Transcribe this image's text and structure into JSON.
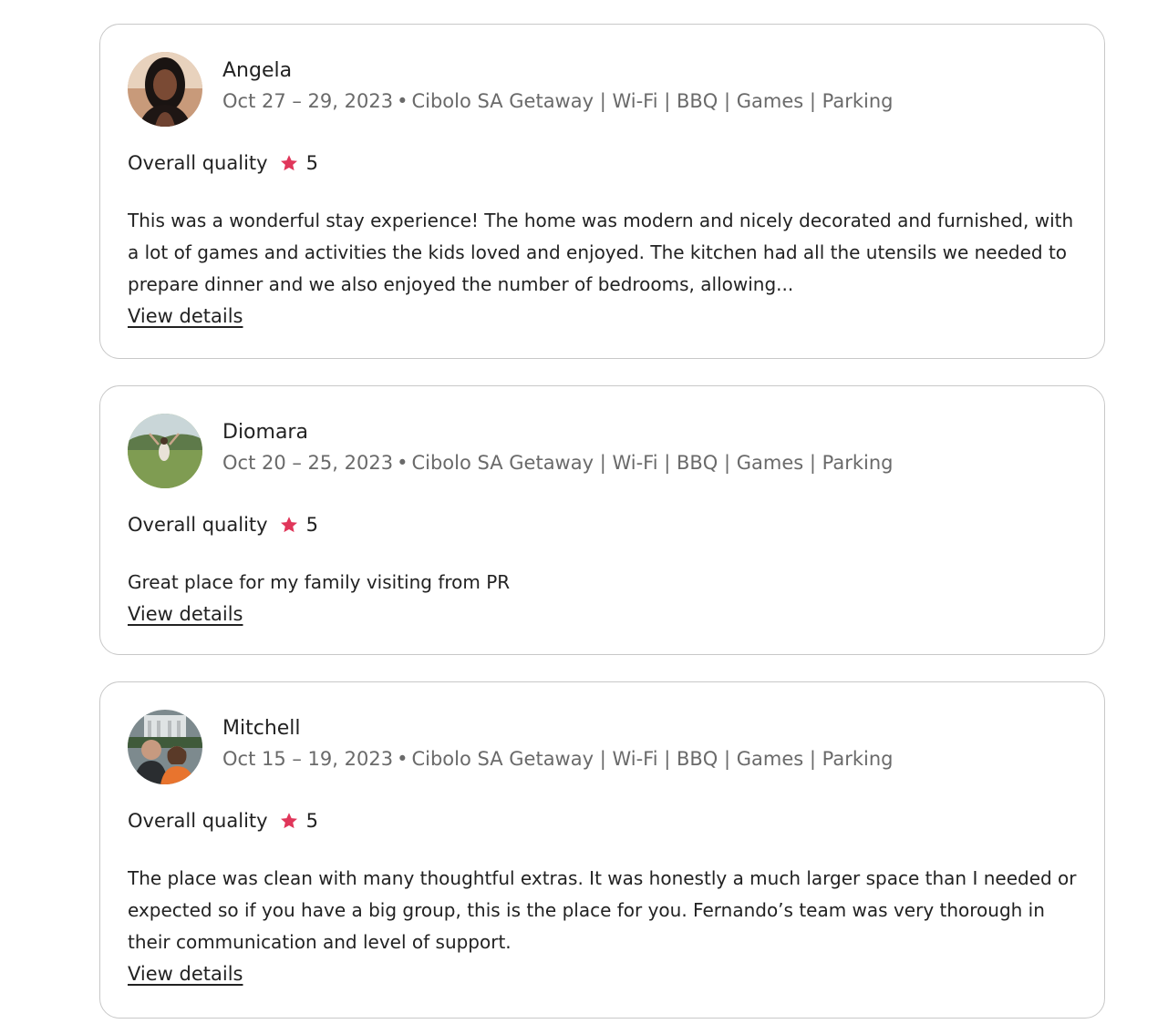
{
  "accent_color": "#e0365a",
  "reviews": [
    {
      "name": "Angela",
      "dates": "Oct 27 – 29, 2023",
      "separator": "•",
      "listing": "Cibolo SA Getaway | Wi-Fi | BBQ | Games | Parking",
      "quality_label": "Overall quality",
      "rating": "5",
      "text": "This was a wonderful stay experience! The home was modern and nicely decorated and furnished, with a lot of games and activities the kids loved and enjoyed. The kitchen had all the utensils we needed to prepare dinner and we also enjoyed the number of bedrooms, allowing...",
      "link_label": "View details",
      "avatar_icon": "person-portrait-icon"
    },
    {
      "name": "Diomara",
      "dates": "Oct 20 – 25, 2023",
      "separator": "•",
      "listing": "Cibolo SA Getaway | Wi-Fi | BBQ | Games | Parking",
      "quality_label": "Overall quality",
      "rating": "5",
      "text": "Great place for my family visiting from PR",
      "link_label": "View details",
      "avatar_icon": "outdoor-photo-icon"
    },
    {
      "name": "Mitchell",
      "dates": "Oct 15 – 19, 2023",
      "separator": "•",
      "listing": "Cibolo SA Getaway | Wi-Fi | BBQ | Games | Parking",
      "quality_label": "Overall quality",
      "rating": "5",
      "text": "The place was clean with many thoughtful extras. It was honestly a much larger space than I needed or expected so if you have a big group, this is the place for you. Fernando’s team was very thorough in their communication and level of support.",
      "link_label": "View details",
      "avatar_icon": "couple-photo-icon"
    }
  ]
}
